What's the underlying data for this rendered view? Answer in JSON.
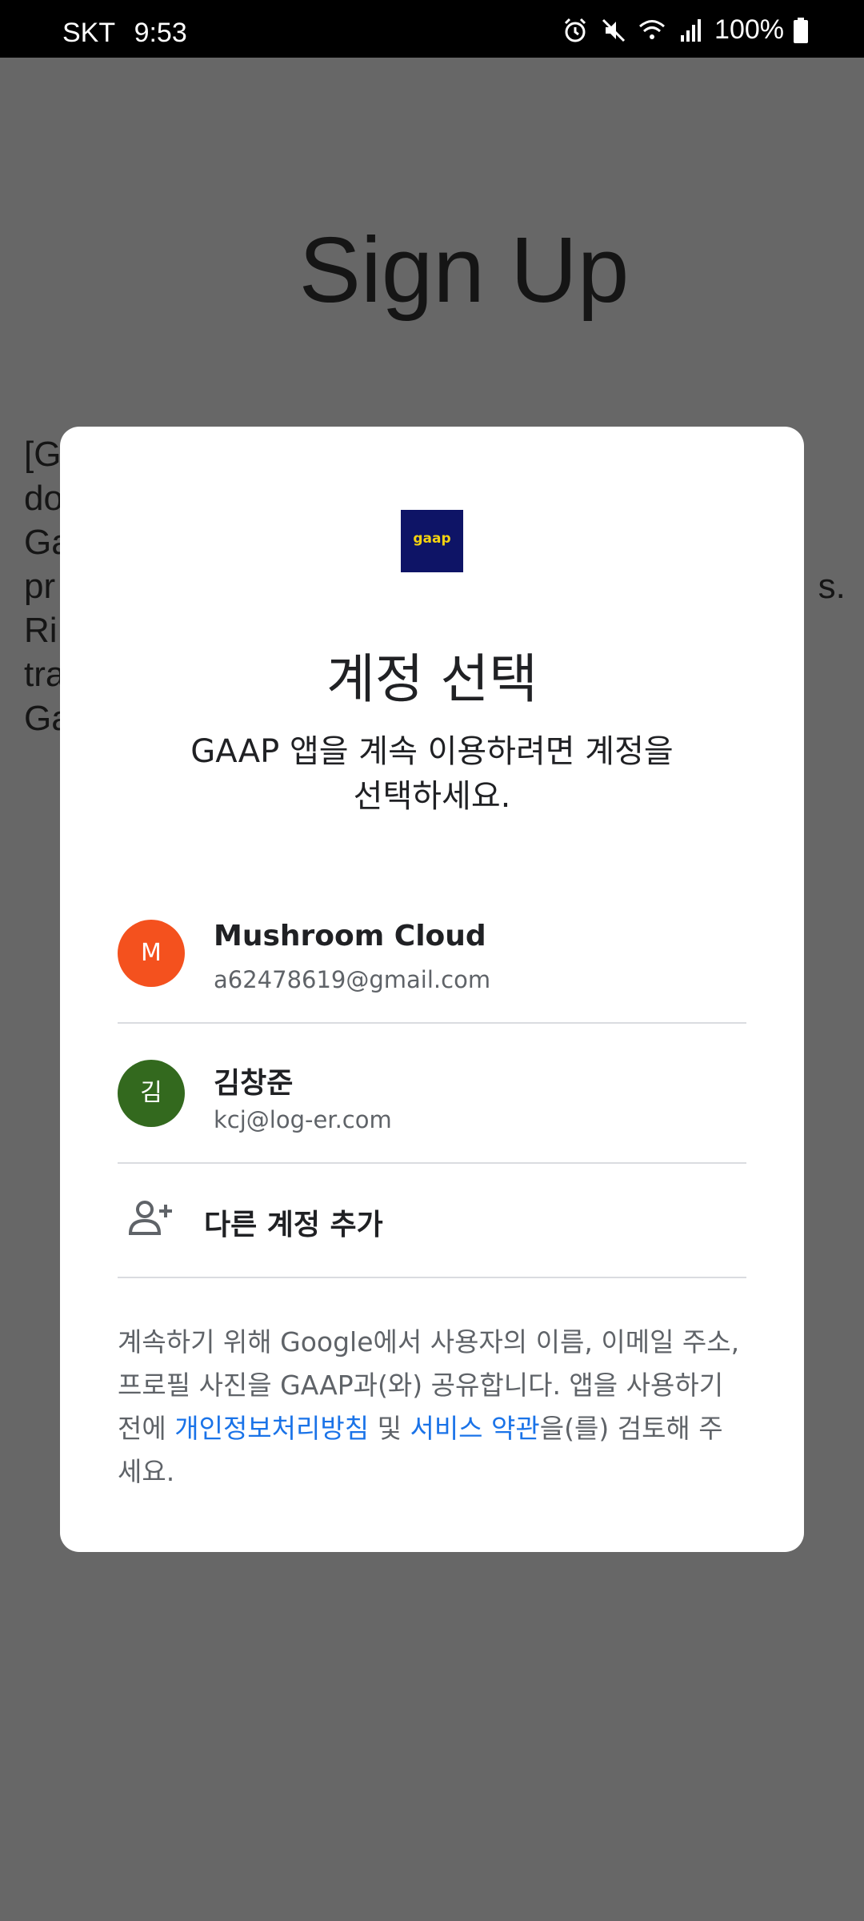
{
  "status_bar": {
    "carrier": "SKT",
    "time": "9:53",
    "battery": "100%"
  },
  "background": {
    "title": "Sign Up",
    "paragraph": "[G\ndo\nGa\npr                                                                              s.\nRi\ntra\nGa"
  },
  "dialog": {
    "logo_text": "gaap",
    "title": "계정 선택",
    "subtitle": "GAAP 앱을 계속 이용하려면 계정을 선택하세요.",
    "accounts": [
      {
        "name": "Mushroom Cloud",
        "email": "a62478619@gmail.com",
        "initial": "M",
        "color": "#f4511e"
      },
      {
        "name": "김창준",
        "email": "kcj@log-er.com",
        "initial": "김",
        "color": "#33691e"
      }
    ],
    "add_account": "다른 계정 추가",
    "disclaimer": {
      "part1": "계속하기 위해 Google에서 사용자의 이름, 이메일 주소, 프로필 사진을 GAAP과(와) 공유합니다. 앱을 사용하기 전에 ",
      "privacy_link": "개인정보처리방침",
      "part2": " 및 ",
      "terms_link": "서비스 약관",
      "part3": "을(를) 검토해 주세요."
    }
  }
}
